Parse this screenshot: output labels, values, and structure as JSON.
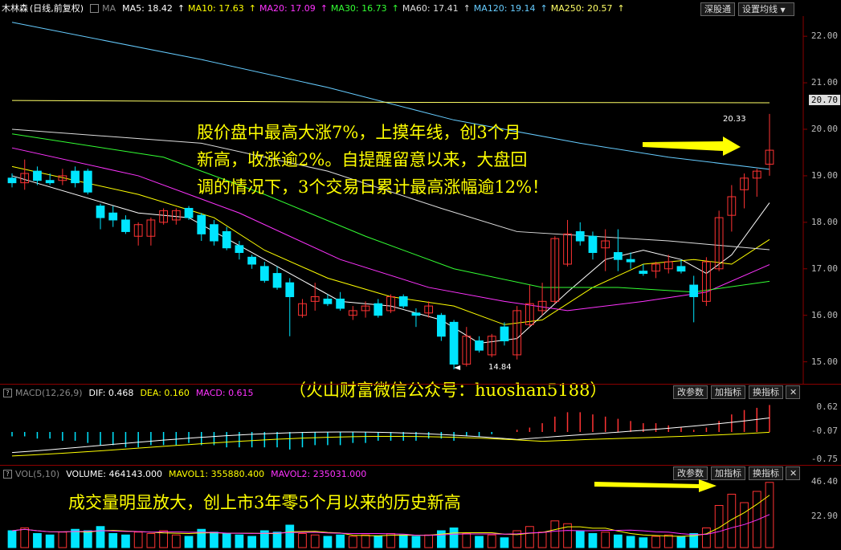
{
  "header": {
    "name": "木林森",
    "period": "(日线,前复权)",
    "ma_label": "MA",
    "ma": [
      {
        "label": "MA5: 18.42",
        "color": "#ffffff"
      },
      {
        "label": "MA10: 17.63",
        "color": "#ffff00"
      },
      {
        "label": "MA20: 17.09",
        "color": "#ff33ff"
      },
      {
        "label": "MA30: 16.73",
        "color": "#33ff33"
      },
      {
        "label": "MA60: 17.41",
        "color": "#dddddd"
      },
      {
        "label": "MA120: 19.14",
        "color": "#66ccff"
      },
      {
        "label": "MA250: 20.57",
        "color": "#ffff66"
      }
    ],
    "btn_sgt": "深股通",
    "btn_setma": "设置均线"
  },
  "price_axis": [
    "22.00",
    "21.00",
    "20.00",
    "19.00",
    "18.00",
    "17.00",
    "16.00",
    "15.00"
  ],
  "price_highlight": "20.70",
  "high_label": "20.33",
  "low_label": "14.84",
  "annotation_main": {
    "line1": "股价盘中最高大涨7%，上摸年线，创3个月",
    "line2": "新高，收涨逾2%。自提醒留意以来，大盘回",
    "line3": "调的情况下，3个交易日累计最高涨幅逾12%！"
  },
  "annotation_wechat": "（火山财富微信公众号：huoshan5188）",
  "macd": {
    "title": "MACD(12,26,9)",
    "dif": "DIF: 0.468",
    "dea": "DEA: 0.160",
    "macd": "MACD: 0.615",
    "axis": [
      "0.62",
      "-0.07",
      "-0.75"
    ],
    "btn_param": "改参数",
    "btn_add": "加指标",
    "btn_switch": "换指标"
  },
  "vol": {
    "title": "VOL(5,10)",
    "volume": "VOLUME: 464143.000",
    "mavol1": "MAVOL1: 355880.400",
    "mavol2": "MAVOL2: 235031.000",
    "axis": [
      "46.40",
      "22.90"
    ],
    "btn_param": "改参数",
    "btn_add": "加指标",
    "btn_switch": "换指标",
    "annotation": "成交量明显放大，创上市3年零5个月以来的历史新高"
  },
  "chart_data": {
    "type": "candlestick",
    "candles": [
      [
        18.95,
        19.05,
        18.75,
        18.85
      ],
      [
        18.85,
        19.35,
        18.7,
        19.05
      ],
      [
        19.1,
        19.2,
        18.8,
        18.9
      ],
      [
        18.9,
        19.05,
        18.8,
        18.85
      ],
      [
        18.9,
        19.15,
        18.8,
        19.0
      ],
      [
        19.1,
        19.2,
        18.75,
        18.85
      ],
      [
        19.1,
        19.15,
        18.6,
        18.65
      ],
      [
        18.35,
        18.4,
        17.85,
        18.1
      ],
      [
        18.2,
        18.35,
        17.9,
        18.05
      ],
      [
        18.05,
        18.15,
        17.75,
        17.8
      ],
      [
        17.7,
        18.0,
        17.5,
        17.95
      ],
      [
        17.7,
        18.1,
        17.5,
        18.05
      ],
      [
        18.0,
        18.3,
        17.95,
        18.25
      ],
      [
        18.05,
        18.3,
        17.95,
        18.25
      ],
      [
        18.3,
        18.35,
        18.05,
        18.1
      ],
      [
        18.15,
        18.2,
        17.6,
        17.75
      ],
      [
        17.95,
        18.05,
        17.5,
        17.6
      ],
      [
        17.8,
        17.9,
        17.4,
        17.45
      ],
      [
        17.5,
        17.6,
        17.2,
        17.35
      ],
      [
        17.25,
        17.3,
        17.0,
        17.1
      ],
      [
        17.05,
        17.15,
        16.7,
        16.75
      ],
      [
        16.9,
        17.05,
        16.55,
        16.6
      ],
      [
        16.7,
        16.8,
        15.55,
        16.4
      ],
      [
        16.0,
        16.35,
        15.95,
        16.25
      ],
      [
        16.3,
        16.7,
        16.1,
        16.4
      ],
      [
        16.35,
        16.45,
        16.2,
        16.25
      ],
      [
        16.35,
        16.5,
        16.1,
        16.15
      ],
      [
        16.0,
        16.2,
        15.9,
        16.1
      ],
      [
        16.1,
        16.3,
        15.95,
        16.2
      ],
      [
        16.25,
        16.35,
        15.95,
        16.0
      ],
      [
        16.1,
        16.45,
        16.05,
        16.4
      ],
      [
        16.4,
        16.45,
        16.15,
        16.2
      ],
      [
        16.05,
        16.15,
        15.75,
        16.0
      ],
      [
        16.05,
        16.3,
        15.95,
        16.2
      ],
      [
        16.0,
        16.05,
        15.45,
        15.55
      ],
      [
        15.85,
        15.9,
        14.84,
        14.95
      ],
      [
        14.95,
        15.75,
        14.9,
        15.55
      ],
      [
        15.45,
        15.55,
        15.2,
        15.25
      ],
      [
        15.15,
        15.6,
        15.1,
        15.55
      ],
      [
        15.75,
        15.85,
        15.35,
        15.45
      ],
      [
        15.15,
        16.2,
        15.05,
        16.1
      ],
      [
        15.8,
        16.65,
        15.75,
        16.25
      ],
      [
        16.1,
        16.7,
        16.0,
        16.3
      ],
      [
        16.3,
        17.7,
        16.25,
        17.65
      ],
      [
        17.1,
        18.05,
        17.05,
        17.75
      ],
      [
        17.8,
        18.0,
        17.5,
        17.6
      ],
      [
        17.7,
        17.8,
        17.2,
        17.35
      ],
      [
        17.45,
        17.85,
        16.95,
        17.6
      ],
      [
        17.35,
        17.85,
        16.95,
        17.2
      ],
      [
        17.2,
        17.35,
        17.0,
        17.15
      ],
      [
        16.95,
        17.1,
        16.85,
        16.9
      ],
      [
        16.95,
        17.15,
        16.8,
        17.1
      ],
      [
        17.0,
        17.3,
        16.9,
        17.15
      ],
      [
        17.05,
        17.2,
        16.9,
        16.95
      ],
      [
        16.65,
        16.85,
        15.85,
        16.4
      ],
      [
        16.3,
        17.25,
        16.2,
        17.15
      ],
      [
        17.0,
        18.25,
        16.95,
        18.1
      ],
      [
        18.15,
        18.8,
        17.8,
        18.55
      ],
      [
        18.7,
        19.05,
        18.3,
        18.95
      ],
      [
        18.95,
        19.15,
        18.55,
        19.1
      ],
      [
        19.25,
        20.33,
        19.0,
        19.55
      ]
    ],
    "volumes": [
      12,
      14,
      10,
      9,
      11,
      13,
      12,
      15,
      10,
      9,
      11,
      10,
      12,
      9,
      8,
      13,
      11,
      10,
      9,
      8,
      12,
      11,
      16,
      10,
      9,
      8,
      9,
      8,
      9,
      8,
      10,
      9,
      8,
      9,
      12,
      14,
      10,
      8,
      9,
      7,
      12,
      15,
      11,
      19,
      17,
      12,
      10,
      11,
      9,
      8,
      7,
      8,
      9,
      8,
      10,
      14,
      30,
      38,
      32,
      40,
      46.4
    ],
    "ma": [
      {
        "name": "MA5",
        "color": "#ffffff",
        "points": [
          [
            0,
            19.0
          ],
          [
            10,
            18.2
          ],
          [
            14,
            18.1
          ],
          [
            18,
            17.5
          ],
          [
            22,
            16.9
          ],
          [
            26,
            16.3
          ],
          [
            30,
            16.2
          ],
          [
            34,
            15.9
          ],
          [
            37,
            15.4
          ],
          [
            40,
            15.5
          ],
          [
            44,
            16.5
          ],
          [
            47,
            17.2
          ],
          [
            50,
            17.4
          ],
          [
            53,
            17.2
          ],
          [
            55,
            16.9
          ],
          [
            57,
            17.3
          ],
          [
            60,
            18.42
          ]
        ]
      },
      {
        "name": "MA10",
        "color": "#ffff00",
        "points": [
          [
            0,
            19.2
          ],
          [
            10,
            18.6
          ],
          [
            16,
            18.1
          ],
          [
            20,
            17.4
          ],
          [
            25,
            16.8
          ],
          [
            30,
            16.4
          ],
          [
            35,
            16.2
          ],
          [
            39,
            15.8
          ],
          [
            42,
            15.9
          ],
          [
            46,
            16.6
          ],
          [
            50,
            17.1
          ],
          [
            54,
            17.2
          ],
          [
            57,
            17.1
          ],
          [
            60,
            17.63
          ]
        ]
      },
      {
        "name": "MA20",
        "color": "#ff33ff",
        "points": [
          [
            0,
            19.6
          ],
          [
            10,
            19.0
          ],
          [
            18,
            18.2
          ],
          [
            26,
            17.2
          ],
          [
            33,
            16.6
          ],
          [
            39,
            16.3
          ],
          [
            44,
            16.1
          ],
          [
            50,
            16.3
          ],
          [
            55,
            16.5
          ],
          [
            60,
            17.09
          ]
        ]
      },
      {
        "name": "MA30",
        "color": "#33ff33",
        "points": [
          [
            0,
            19.9
          ],
          [
            12,
            19.4
          ],
          [
            20,
            18.6
          ],
          [
            28,
            17.7
          ],
          [
            35,
            17.0
          ],
          [
            42,
            16.6
          ],
          [
            48,
            16.6
          ],
          [
            54,
            16.5
          ],
          [
            60,
            16.73
          ]
        ]
      },
      {
        "name": "MA60",
        "color": "#dddddd",
        "points": [
          [
            0,
            20.0
          ],
          [
            15,
            19.7
          ],
          [
            25,
            19.1
          ],
          [
            34,
            18.3
          ],
          [
            40,
            17.8
          ],
          [
            46,
            17.7
          ],
          [
            52,
            17.6
          ],
          [
            60,
            17.41
          ]
        ]
      },
      {
        "name": "MA120",
        "color": "#66ccff",
        "points": [
          [
            0,
            22.3
          ],
          [
            15,
            21.5
          ],
          [
            25,
            20.9
          ],
          [
            35,
            20.2
          ],
          [
            45,
            19.7
          ],
          [
            52,
            19.4
          ],
          [
            60,
            19.14
          ]
        ]
      },
      {
        "name": "MA250",
        "color": "#ffff66",
        "points": [
          [
            0,
            20.62
          ],
          [
            30,
            20.58
          ],
          [
            60,
            20.57
          ]
        ]
      }
    ],
    "macd_hist": [
      -0.1,
      -0.1,
      -0.15,
      -0.15,
      -0.2,
      -0.2,
      -0.25,
      -0.3,
      -0.3,
      -0.35,
      -0.35,
      -0.3,
      -0.3,
      -0.3,
      -0.25,
      -0.3,
      -0.3,
      -0.35,
      -0.35,
      -0.35,
      -0.35,
      -0.35,
      -0.4,
      -0.35,
      -0.3,
      -0.3,
      -0.3,
      -0.25,
      -0.25,
      -0.2,
      -0.2,
      -0.2,
      -0.2,
      -0.15,
      -0.15,
      -0.2,
      -0.1,
      -0.1,
      -0.05,
      0,
      0.05,
      0.1,
      0.2,
      0.35,
      0.45,
      0.45,
      0.4,
      0.35,
      0.3,
      0.25,
      0.2,
      0.2,
      0.15,
      0.1,
      0.05,
      0.1,
      0.25,
      0.4,
      0.5,
      0.55,
      0.615
    ],
    "price_range": [
      14.7,
      22.4
    ]
  }
}
